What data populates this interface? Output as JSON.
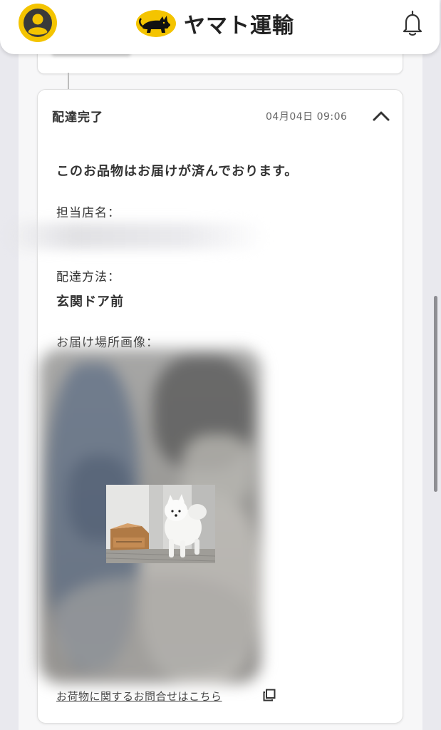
{
  "header": {
    "brand_name": "ヤマト運輸",
    "avatar_icon": "user-avatar-icon",
    "bell_icon": "bell-icon",
    "brand_color": "#f4c400"
  },
  "delivery_card": {
    "status_title": "配達完了",
    "timestamp": "04月04日 09:06",
    "toggle_icon": "chevron-up-icon",
    "message": "このお品物はお届けが済んでおります。",
    "store_label": "担当店名：",
    "store_value": "",
    "method_label": "配達方法：",
    "method_value": "玄関ドア前",
    "photo_label": "お届け場所画像：",
    "inquiry_link": "お荷物に関するお問合せはこちら",
    "link_icon": "external-link-icon"
  }
}
